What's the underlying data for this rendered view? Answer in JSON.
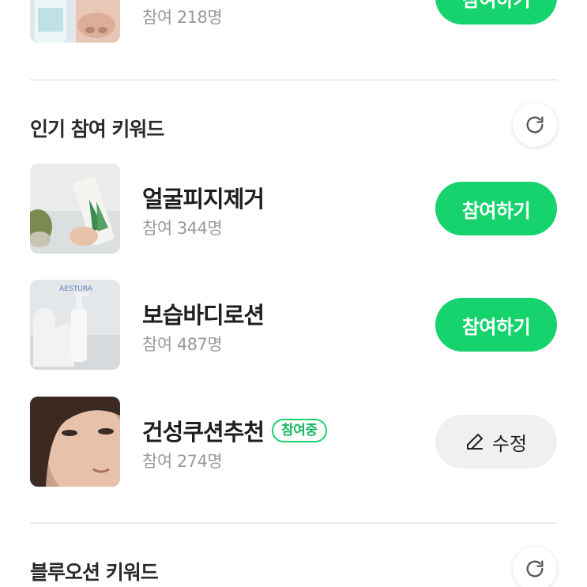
{
  "top_item": {
    "count": "참여 218명",
    "button": "참여하기"
  },
  "popular": {
    "title": "인기 참여 키워드",
    "items": [
      {
        "keyword": "얼굴피지제거",
        "count": "참여 344명",
        "button": "참여하기"
      },
      {
        "keyword": "보습바디로션",
        "count": "참여 487명",
        "button": "참여하기",
        "thumb_brand": "AESTURA"
      },
      {
        "keyword": "건성쿠션추천",
        "badge": "참여중",
        "count": "참여 274명",
        "edit_button": "수정"
      }
    ]
  },
  "blue_ocean": {
    "title": "블루오션 키워드"
  },
  "colors": {
    "accent": "#16d36d",
    "divider": "#ececec",
    "muted_text": "#9a9a9a"
  },
  "icons": [
    "refresh-icon",
    "pencil-icon"
  ]
}
